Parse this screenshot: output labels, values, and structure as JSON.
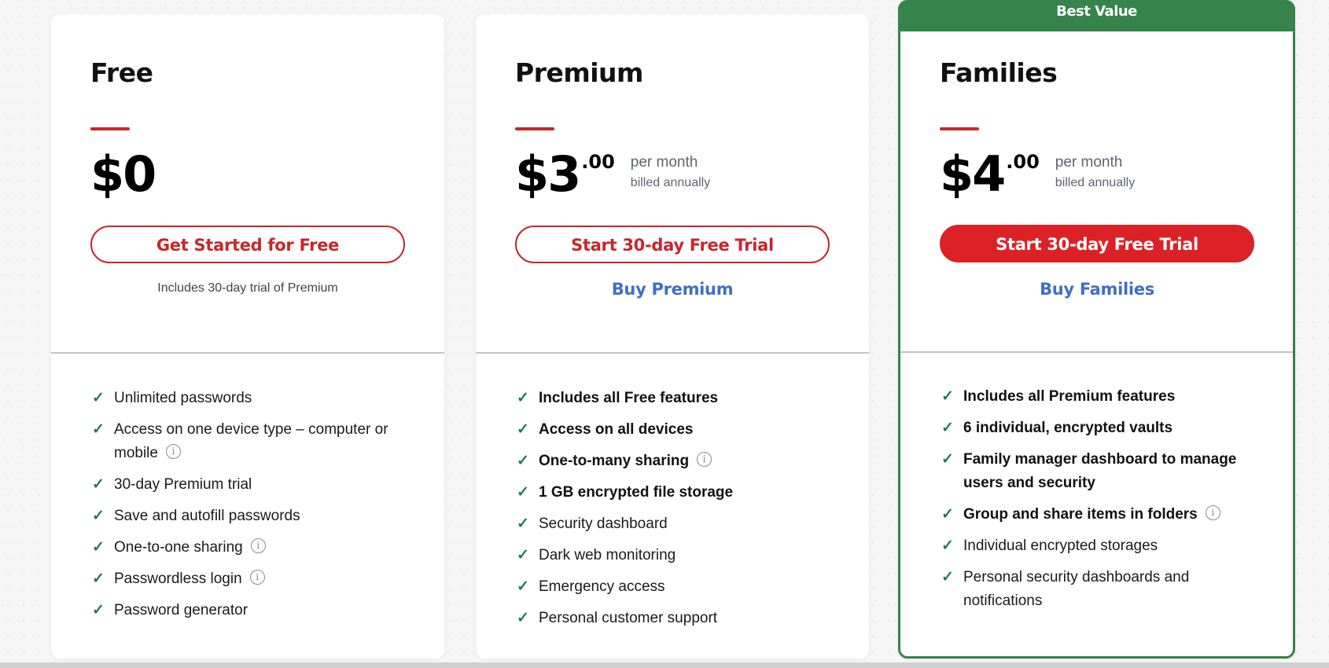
{
  "colors": {
    "accent_red": "#c8262b",
    "primary_button_red": "#dc2126",
    "best_value_green": "#37834c",
    "link_blue": "#3f6fc4",
    "check_green": "#1f7a5a"
  },
  "plans": [
    {
      "name": "Free",
      "price_main": "$0",
      "price_cents": "",
      "price_note_1": "",
      "price_note_2": "",
      "cta_label": "Get Started for Free",
      "subnote": "Includes 30-day trial of Premium",
      "features": [
        {
          "text": "Unlimited passwords",
          "bold": false,
          "info": false
        },
        {
          "text": "Access on one device type – computer or mobile",
          "bold": false,
          "info": true
        },
        {
          "text": "30-day Premium trial",
          "bold": false,
          "info": false
        },
        {
          "text": "Save and autofill passwords",
          "bold": false,
          "info": false
        },
        {
          "text": "One-to-one sharing",
          "bold": false,
          "info": true
        },
        {
          "text": "Passwordless login",
          "bold": false,
          "info": true
        },
        {
          "text": "Password generator",
          "bold": false,
          "info": false
        }
      ]
    },
    {
      "name": "Premium",
      "price_main": "$3",
      "price_cents": ".00",
      "price_note_1": "per month",
      "price_note_2": "billed annually",
      "cta_label": "Start 30-day Free Trial",
      "buy_label": "Buy Premium",
      "features": [
        {
          "text": "Includes all Free features",
          "bold": true,
          "info": false
        },
        {
          "text": "Access on all devices",
          "bold": true,
          "info": false
        },
        {
          "text": "One-to-many sharing",
          "bold": true,
          "info": true
        },
        {
          "text": "1 GB encrypted file storage",
          "bold": true,
          "info": false
        },
        {
          "text": "Security dashboard",
          "bold": false,
          "info": false
        },
        {
          "text": "Dark web monitoring",
          "bold": false,
          "info": false
        },
        {
          "text": "Emergency access",
          "bold": false,
          "info": false
        },
        {
          "text": "Personal customer support",
          "bold": false,
          "info": false
        }
      ]
    },
    {
      "badge": "Best Value",
      "name": "Families",
      "price_main": "$4",
      "price_cents": ".00",
      "price_note_1": "per month",
      "price_note_2": "billed annually",
      "cta_label": "Start 30-day Free Trial",
      "buy_label": "Buy Families",
      "features": [
        {
          "text": "Includes all Premium features",
          "bold": true,
          "info": false
        },
        {
          "text": "6 individual, encrypted vaults",
          "bold": true,
          "info": false
        },
        {
          "text": "Family manager dashboard to manage users and security",
          "bold": true,
          "info": false
        },
        {
          "text": "Group and share items in folders",
          "bold": true,
          "info": true
        },
        {
          "text": "Individual encrypted storages",
          "bold": false,
          "info": false
        },
        {
          "text": "Personal security dashboards and notifications",
          "bold": false,
          "info": false
        }
      ]
    }
  ],
  "icons": {
    "check": "✓",
    "info": "i"
  }
}
